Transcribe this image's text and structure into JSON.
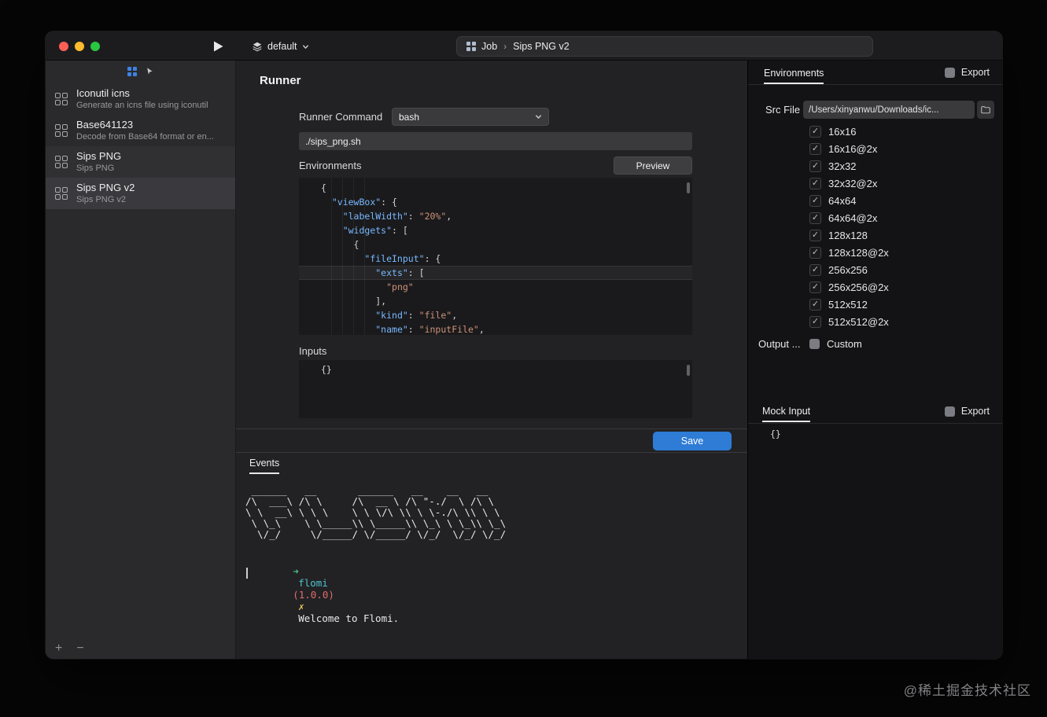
{
  "titlebar": {
    "workspace_label": "default",
    "breadcrumb": {
      "section": "Job",
      "separator": "›",
      "current": "Sips PNG v2"
    }
  },
  "sidebar": {
    "items": [
      {
        "title": "Iconutil icns",
        "subtitle": "Generate an icns file using iconutil",
        "state": "normal"
      },
      {
        "title": "Base641123",
        "subtitle": "Decode from Base64 format or en...",
        "state": "normal"
      },
      {
        "title": "Sips PNG",
        "subtitle": "Sips PNG",
        "state": "active"
      },
      {
        "title": "Sips PNG v2",
        "subtitle": "Sips PNG v2",
        "state": "selected"
      }
    ],
    "add_label": "+",
    "remove_label": "−"
  },
  "runner": {
    "title": "Runner",
    "command_label": "Runner Command",
    "command_value": "bash",
    "script_value": "./sips_png.sh",
    "environments_label": "Environments",
    "preview_label": "Preview",
    "inputs_label": "Inputs",
    "inputs_value": "{}",
    "save_label": "Save",
    "code_lines": [
      {
        "hl": false,
        "seg": [
          {
            "t": "{",
            "c": "p"
          }
        ]
      },
      {
        "hl": false,
        "seg": [
          {
            "t": "  ",
            "c": "p"
          },
          {
            "t": "\"viewBox\"",
            "c": "k"
          },
          {
            "t": ": {",
            "c": "p"
          }
        ]
      },
      {
        "hl": false,
        "seg": [
          {
            "t": "    ",
            "c": "p"
          },
          {
            "t": "\"labelWidth\"",
            "c": "k"
          },
          {
            "t": ": ",
            "c": "p"
          },
          {
            "t": "\"20%\"",
            "c": "s"
          },
          {
            "t": ",",
            "c": "p"
          }
        ]
      },
      {
        "hl": false,
        "seg": [
          {
            "t": "    ",
            "c": "p"
          },
          {
            "t": "\"widgets\"",
            "c": "k"
          },
          {
            "t": ": [",
            "c": "p"
          }
        ]
      },
      {
        "hl": false,
        "seg": [
          {
            "t": "      {",
            "c": "p"
          }
        ]
      },
      {
        "hl": false,
        "seg": [
          {
            "t": "        ",
            "c": "p"
          },
          {
            "t": "\"fileInput\"",
            "c": "k"
          },
          {
            "t": ": {",
            "c": "p"
          }
        ]
      },
      {
        "hl": true,
        "seg": [
          {
            "t": "          ",
            "c": "p"
          },
          {
            "t": "\"exts\"",
            "c": "k"
          },
          {
            "t": ": [",
            "c": "p"
          }
        ]
      },
      {
        "hl": false,
        "seg": [
          {
            "t": "            ",
            "c": "p"
          },
          {
            "t": "\"png\"",
            "c": "s"
          }
        ]
      },
      {
        "hl": false,
        "seg": [
          {
            "t": "          ],",
            "c": "p"
          }
        ]
      },
      {
        "hl": false,
        "seg": [
          {
            "t": "          ",
            "c": "p"
          },
          {
            "t": "\"kind\"",
            "c": "k"
          },
          {
            "t": ": ",
            "c": "p"
          },
          {
            "t": "\"file\"",
            "c": "s"
          },
          {
            "t": ",",
            "c": "p"
          }
        ]
      },
      {
        "hl": false,
        "seg": [
          {
            "t": "          ",
            "c": "p"
          },
          {
            "t": "\"name\"",
            "c": "k"
          },
          {
            "t": ": ",
            "c": "p"
          },
          {
            "t": "\"inputFile\"",
            "c": "s"
          },
          {
            "t": ",",
            "c": "p"
          }
        ]
      }
    ]
  },
  "events": {
    "tab_label": "Events",
    "ascii_art": [
      " ______   __       ______   __    __   __   ",
      "/\\  ___\\ /\\ \\     /\\  __ \\ /\\ \"-./  \\ /\\ \\  ",
      "\\ \\  __\\ \\ \\ \\    \\ \\ \\/\\ \\\\ \\ \\-./\\ \\\\ \\ \\ ",
      " \\ \\_\\    \\ \\_____\\\\ \\_____\\\\ \\_\\ \\ \\_\\\\ \\_\\",
      "  \\/_/     \\/_____/ \\/_____/ \\/_/  \\/_/ \\/_/"
    ],
    "terminal": {
      "prompt": "➜",
      "app": "flomi",
      "version": "(1.0.0)",
      "mark": "✗",
      "message": "Welcome to Flomi."
    }
  },
  "environments_panel": {
    "tab_label": "Environments",
    "export_label": "Export",
    "src_file_label": "Src File",
    "src_file_value": "/Users/xinyanwu/Downloads/ic...",
    "check_glyph": "✓",
    "sizes": [
      "16x16",
      "16x16@2x",
      "32x32",
      "32x32@2x",
      "64x64",
      "64x64@2x",
      "128x128",
      "128x128@2x",
      "256x256",
      "256x256@2x",
      "512x512",
      "512x512@2x"
    ],
    "output_label": "Output ...",
    "custom_label": "Custom"
  },
  "mock_panel": {
    "tab_label": "Mock Input",
    "export_label": "Export",
    "value": "{}"
  },
  "watermark": "@稀土掘金技术社区",
  "colors": {
    "accent_blue": "#2e7cd6",
    "traffic_red": "#ff5f57",
    "traffic_yellow": "#febc2e",
    "traffic_green": "#28c840",
    "code_key": "#79b8ff",
    "code_string": "#ce9178",
    "term_green": "#4cc38a",
    "term_cyan": "#53c2cf",
    "term_red": "#e06c6c",
    "term_yellow": "#e7c75a"
  }
}
